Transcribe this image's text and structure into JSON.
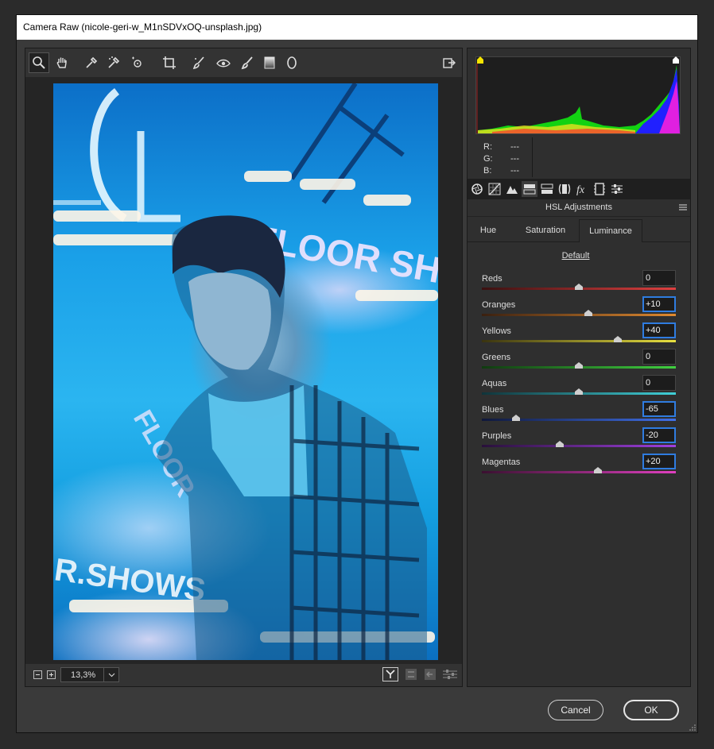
{
  "window": {
    "title": "Camera Raw (nicole-geri-w_M1nSDVxOQ-unsplash.jpg)"
  },
  "toolbar": {
    "tools": [
      {
        "name": "zoom-tool",
        "icon": "magnifier-icon",
        "active": true
      },
      {
        "name": "hand-tool",
        "icon": "hand-icon"
      },
      {
        "name": "white-balance-tool",
        "icon": "eyedropper-icon"
      },
      {
        "name": "color-sampler-tool",
        "icon": "sampler-icon"
      },
      {
        "name": "targeted-adjustment-tool",
        "icon": "target-icon"
      },
      {
        "name": "crop-tool",
        "icon": "crop-icon"
      },
      {
        "name": "spot-removal-tool",
        "icon": "spot-brush-icon"
      },
      {
        "name": "red-eye-tool",
        "icon": "eye-icon"
      },
      {
        "name": "adjustment-brush-tool",
        "icon": "brush-icon"
      },
      {
        "name": "graduated-filter-tool",
        "icon": "gradient-icon"
      },
      {
        "name": "radial-filter-tool",
        "icon": "ellipse-icon"
      }
    ]
  },
  "zoom": {
    "value": "13,3%"
  },
  "histogram": {
    "r_label": "R:",
    "g_label": "G:",
    "b_label": "B:",
    "r_value": "---",
    "g_value": "---",
    "b_value": "---"
  },
  "panel": {
    "title": "HSL Adjustments",
    "tabs": [
      {
        "label": "Hue"
      },
      {
        "label": "Saturation"
      },
      {
        "label": "Luminance",
        "selected": true
      }
    ],
    "default_label": "Default",
    "sliders": [
      {
        "label": "Reds",
        "value": "0",
        "pos": 0,
        "colors": [
          "#3a1010",
          "#e04040"
        ]
      },
      {
        "label": "Oranges",
        "value": "+10",
        "pos": 10,
        "colors": [
          "#3a2010",
          "#e08a30"
        ]
      },
      {
        "label": "Yellows",
        "value": "+40",
        "pos": 40,
        "colors": [
          "#3a3410",
          "#e8e040"
        ]
      },
      {
        "label": "Greens",
        "value": "0",
        "pos": 0,
        "colors": [
          "#103a10",
          "#40d040"
        ]
      },
      {
        "label": "Aquas",
        "value": "0",
        "pos": 0,
        "colors": [
          "#10343a",
          "#40d0d8"
        ]
      },
      {
        "label": "Blues",
        "value": "-65",
        "pos": -65,
        "colors": [
          "#10183a",
          "#4070e8"
        ]
      },
      {
        "label": "Purples",
        "value": "-20",
        "pos": -20,
        "colors": [
          "#28103a",
          "#a040e0"
        ]
      },
      {
        "label": "Magentas",
        "value": "+20",
        "pos": 20,
        "colors": [
          "#3a1030",
          "#e040c0"
        ]
      }
    ]
  },
  "buttons": {
    "cancel": "Cancel",
    "ok": "OK"
  }
}
